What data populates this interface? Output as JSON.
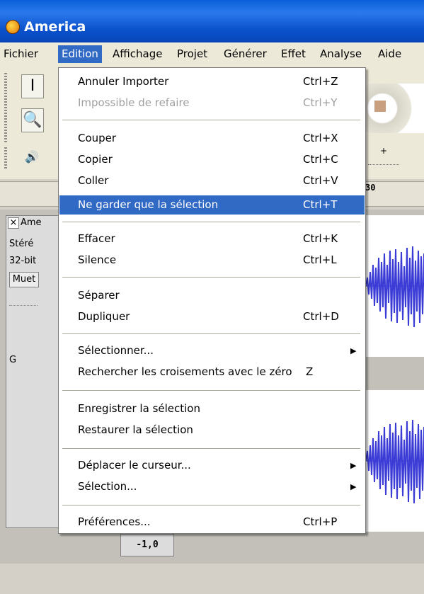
{
  "window": {
    "title": "America"
  },
  "menubar": {
    "items": [
      {
        "label": "Fichier"
      },
      {
        "label": "Edition"
      },
      {
        "label": "Affichage"
      },
      {
        "label": "Projet"
      },
      {
        "label": "Générer"
      },
      {
        "label": "Effet"
      },
      {
        "label": "Analyse"
      },
      {
        "label": "Aide"
      }
    ]
  },
  "ruler": {
    "label": "30"
  },
  "track": {
    "name": "Ame",
    "line1": "Stéré",
    "line2": "32-bit",
    "mute": "Muet",
    "gain_label": "G",
    "scale_label": "-1,0"
  },
  "edit_menu": {
    "items": [
      {
        "label": "Annuler Importer",
        "shortcut": "Ctrl+Z"
      },
      {
        "label": "Impossible de refaire",
        "shortcut": "Ctrl+Y"
      },
      {
        "label": "Couper",
        "shortcut": "Ctrl+X"
      },
      {
        "label": "Copier",
        "shortcut": "Ctrl+C"
      },
      {
        "label": "Coller",
        "shortcut": "Ctrl+V"
      },
      {
        "label": "Ne garder que la sélection",
        "shortcut": "Ctrl+T"
      },
      {
        "label": "Effacer",
        "shortcut": "Ctrl+K"
      },
      {
        "label": "Silence",
        "shortcut": "Ctrl+L"
      },
      {
        "label": "Séparer",
        "shortcut": ""
      },
      {
        "label": "Dupliquer",
        "shortcut": "Ctrl+D"
      },
      {
        "label": "Sélectionner...",
        "shortcut": ""
      },
      {
        "label": "Rechercher les croisements avec le zéro",
        "shortcut": "Z"
      },
      {
        "label": "Enregistrer la sélection",
        "shortcut": ""
      },
      {
        "label": "Restaurer la sélection",
        "shortcut": ""
      },
      {
        "label": "Déplacer le curseur...",
        "shortcut": ""
      },
      {
        "label": "Sélection...",
        "shortcut": ""
      },
      {
        "label": "Préférences...",
        "shortcut": "Ctrl+P"
      }
    ]
  },
  "colors": {
    "menu_highlight": "#316ac5",
    "waveform": "#3b3bd6",
    "titlebar": "#0a52cc"
  },
  "icons": [
    "app-icon",
    "ibeam-cursor-icon",
    "zoom-icon",
    "speaker-icon",
    "submenu-arrow-icon"
  ]
}
